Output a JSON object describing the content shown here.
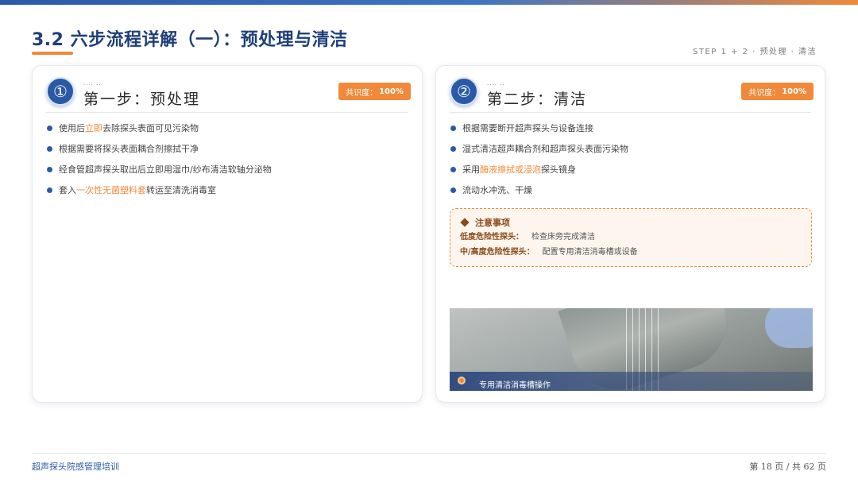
{
  "colors": {
    "primary": "#2a5aa6",
    "accent": "#f08a3a",
    "title": "#1f3f7a"
  },
  "header": {
    "title": "3.2 六步流程详解（一）：预处理与清洁",
    "step_caption": "STEP 1 + 2 · 预处理 · 清洁"
  },
  "step1": {
    "number": "①",
    "dots": "···· ··",
    "heading": "第一步：预处理",
    "consensus_label": "共识度：",
    "consensus_value": "100%",
    "bullets": [
      {
        "before": "使用后",
        "highlight": "立即",
        "after": "去除探头表面可见污染物"
      },
      {
        "before": "根据需要将探头表面耦合剂擦拭干净",
        "highlight": "",
        "after": ""
      },
      {
        "before": "经食管超声探头取出后立即用湿巾/纱布清洁软轴分泌物",
        "highlight": "",
        "after": ""
      },
      {
        "before": "套入",
        "highlight": "一次性无菌塑料套",
        "after": "转运至清洗消毒室"
      }
    ]
  },
  "step2": {
    "number": "②",
    "dots": "···· ··",
    "heading": "第二步：清洁",
    "consensus_label": "共识度：",
    "consensus_value": "100%",
    "bullets": [
      {
        "before": "根据需要断开超声探头与设备连接",
        "highlight": "",
        "after": ""
      },
      {
        "before": "湿式清洁超声耦合剂和超声探头表面污染物",
        "highlight": "",
        "after": ""
      },
      {
        "before": "采用",
        "highlight": "酶液擦拭或浸泡",
        "after": "探头镜身"
      },
      {
        "before": "流动水冲洗、干燥",
        "highlight": "",
        "after": ""
      }
    ],
    "notice": {
      "title": "注意事项",
      "rows": [
        {
          "key": "低度危险性探头：",
          "value": "检查床旁完成清洁"
        },
        {
          "key": "中/高度危险性探头：",
          "value": "配置专用清洁消毒槽或设备"
        }
      ]
    },
    "photo_caption": "专用清洁消毒槽操作"
  },
  "footer": {
    "left": "超声探头院感管理培训",
    "right": "第 18 页 / 共 62 页"
  }
}
